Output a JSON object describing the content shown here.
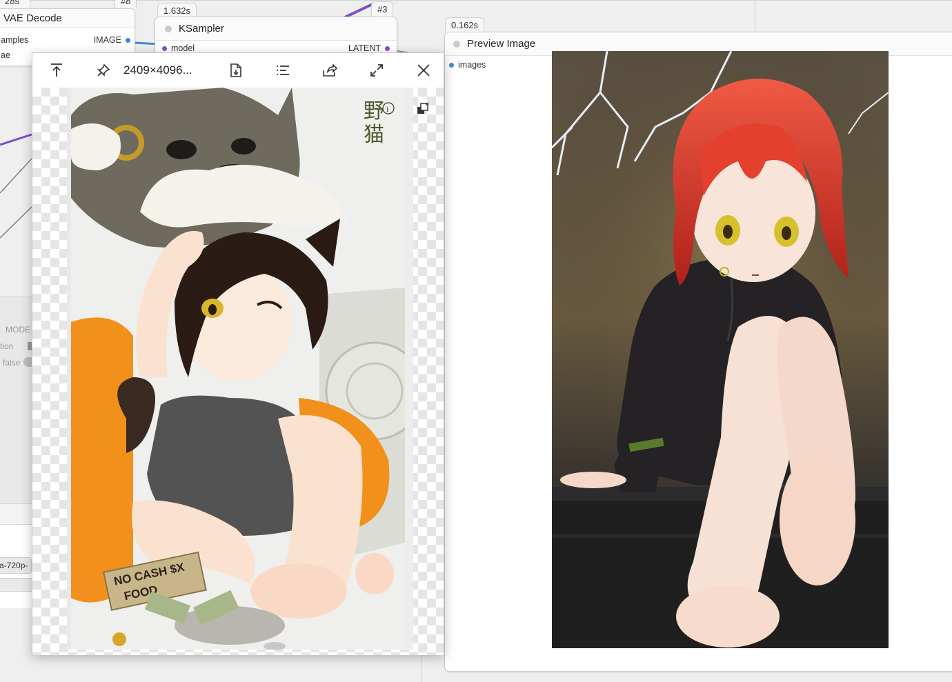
{
  "nodes": {
    "vae_decode": {
      "badge_time": "28s",
      "badge_id": "#8",
      "title": "VAE Decode",
      "inputs": [
        "amples",
        "ae"
      ],
      "output": "IMAGE"
    },
    "ksampler": {
      "badge_time": "1.632s",
      "badge_id": "#3",
      "title": "KSampler",
      "input": "model",
      "output": "LATENT"
    },
    "preview": {
      "badge_time": "0.162s",
      "title": "Preview Image",
      "input": "images"
    }
  },
  "left_node": {
    "mode_label": "MODE",
    "row1": "tion",
    "row2": "false",
    "file_label": "a-720p-"
  },
  "viewer": {
    "dimensions": "2409×4096...",
    "toolbar_icons": [
      "align-top-icon",
      "pin-icon",
      "save-icon",
      "list-icon",
      "share-icon",
      "expand-icon",
      "close-icon"
    ],
    "stamp_chars": [
      "野",
      "猫"
    ],
    "sign_line1": "NO CASH $X",
    "sign_line2": "FOOD"
  },
  "colors": {
    "image_slot": "#3a8be0",
    "latent_slot": "#8a4bd0",
    "model_slot": "#8a4bd0",
    "wire_purple": "#7d4ec7",
    "wire_blue": "#3a8be0",
    "wire_orange": "#e8a23a",
    "images_slot": "#3a8be0"
  }
}
